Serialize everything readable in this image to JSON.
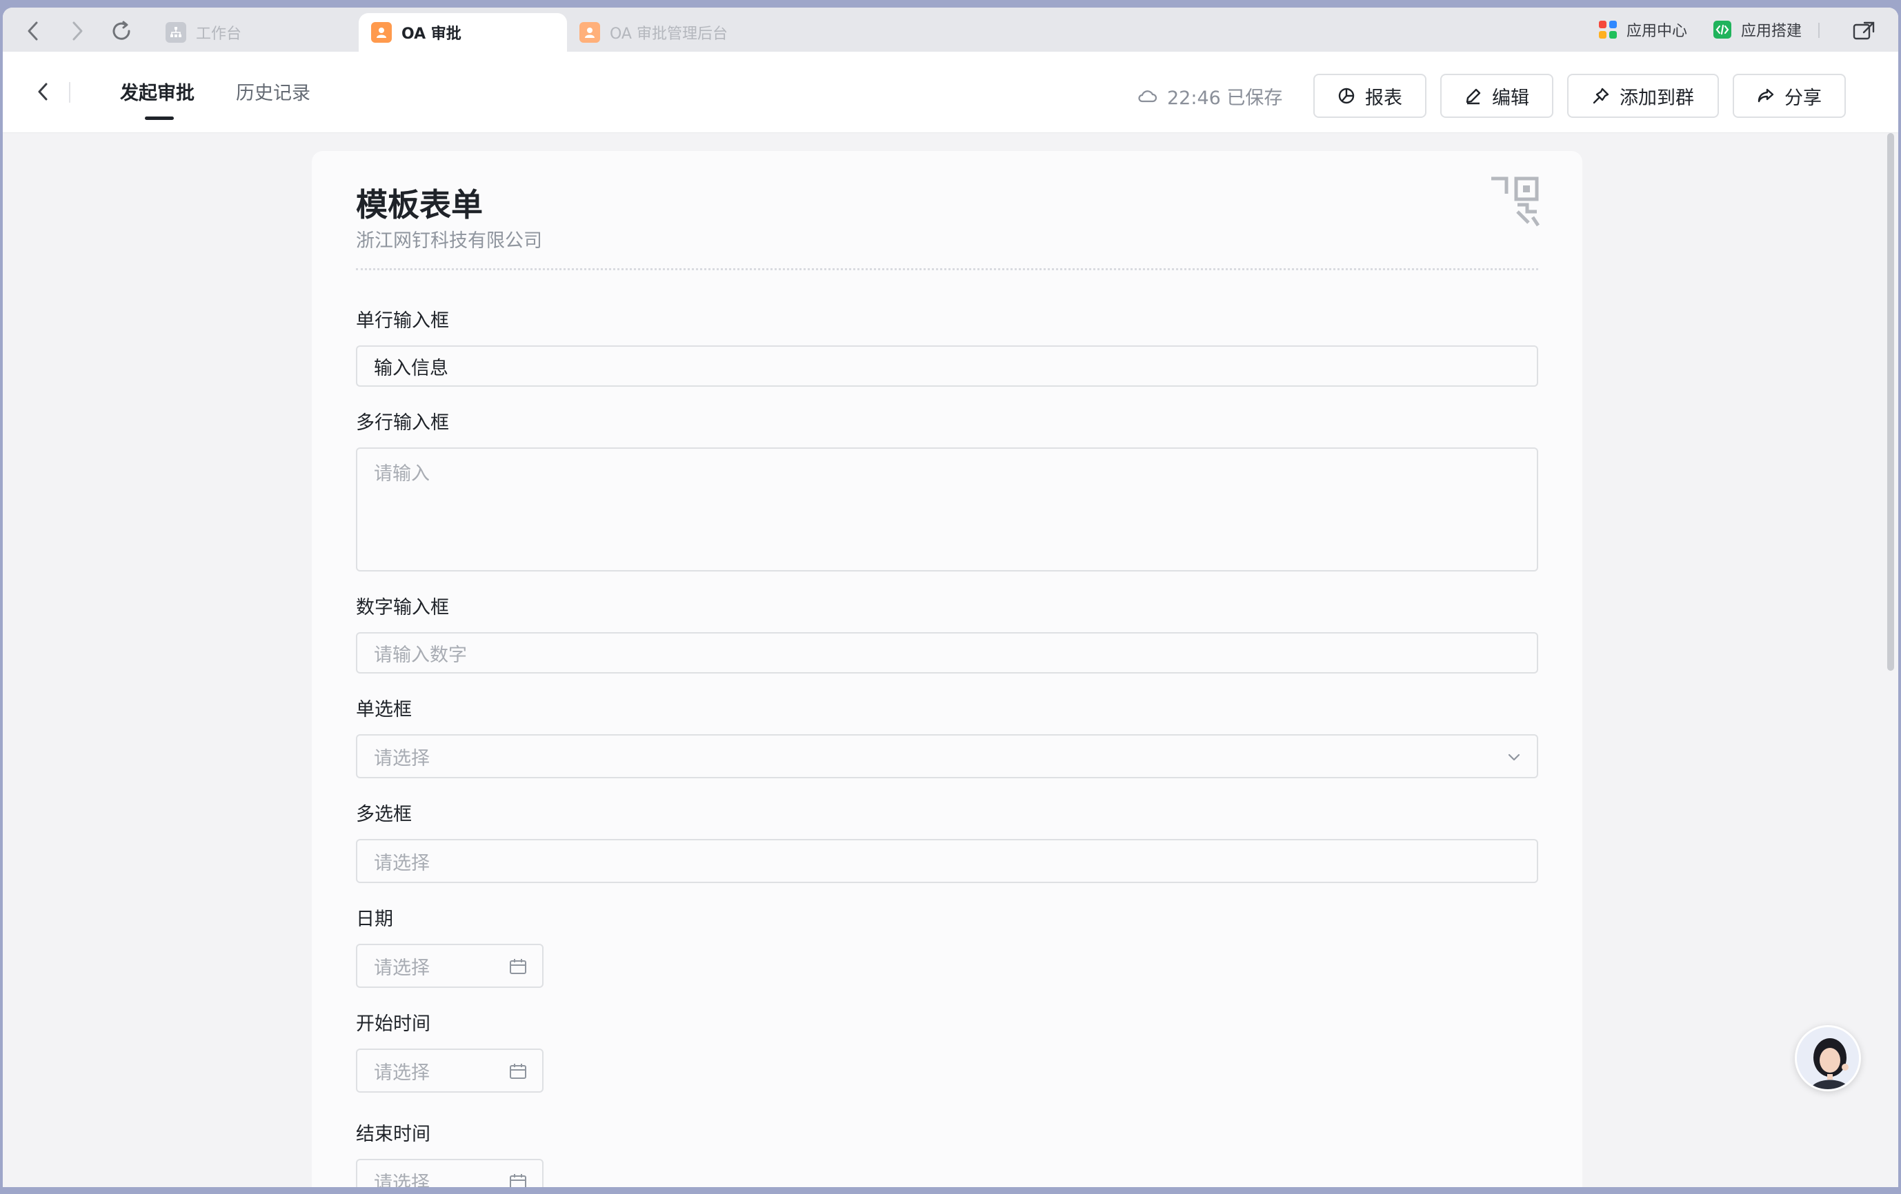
{
  "browser": {
    "tabs": [
      {
        "label": "工作台",
        "active": false
      },
      {
        "label": "OA 审批",
        "active": true
      },
      {
        "label": "OA 审批管理后台",
        "active": false
      }
    ],
    "app_center_label": "应用中心",
    "app_builder_label": "应用搭建"
  },
  "header": {
    "tabs": [
      {
        "label": "发起审批",
        "active": true
      },
      {
        "label": "历史记录",
        "active": false
      }
    ],
    "save_status": "22:46 已保存",
    "buttons": {
      "report": "报表",
      "edit": "编辑",
      "add_to_group": "添加到群",
      "share": "分享"
    }
  },
  "form": {
    "title": "模板表单",
    "subtitle": "浙江网钉科技有限公司",
    "fields": {
      "single_line": {
        "label": "单行输入框",
        "value": "输入信息"
      },
      "multi_line": {
        "label": "多行输入框",
        "placeholder": "请输入"
      },
      "number": {
        "label": "数字输入框",
        "placeholder": "请输入数字"
      },
      "radio": {
        "label": "单选框",
        "placeholder": "请选择"
      },
      "checkbox": {
        "label": "多选框",
        "placeholder": "请选择"
      },
      "date": {
        "label": "日期",
        "placeholder": "请选择"
      },
      "start_time": {
        "label": "开始时间",
        "placeholder": "请选择"
      },
      "end_time": {
        "label": "结束时间",
        "placeholder": "请选择"
      }
    }
  },
  "colors": {
    "background": "#f3f3f5",
    "text_primary": "#1f2329",
    "text_placeholder": "#a8acb3",
    "border": "#dee0e3"
  }
}
